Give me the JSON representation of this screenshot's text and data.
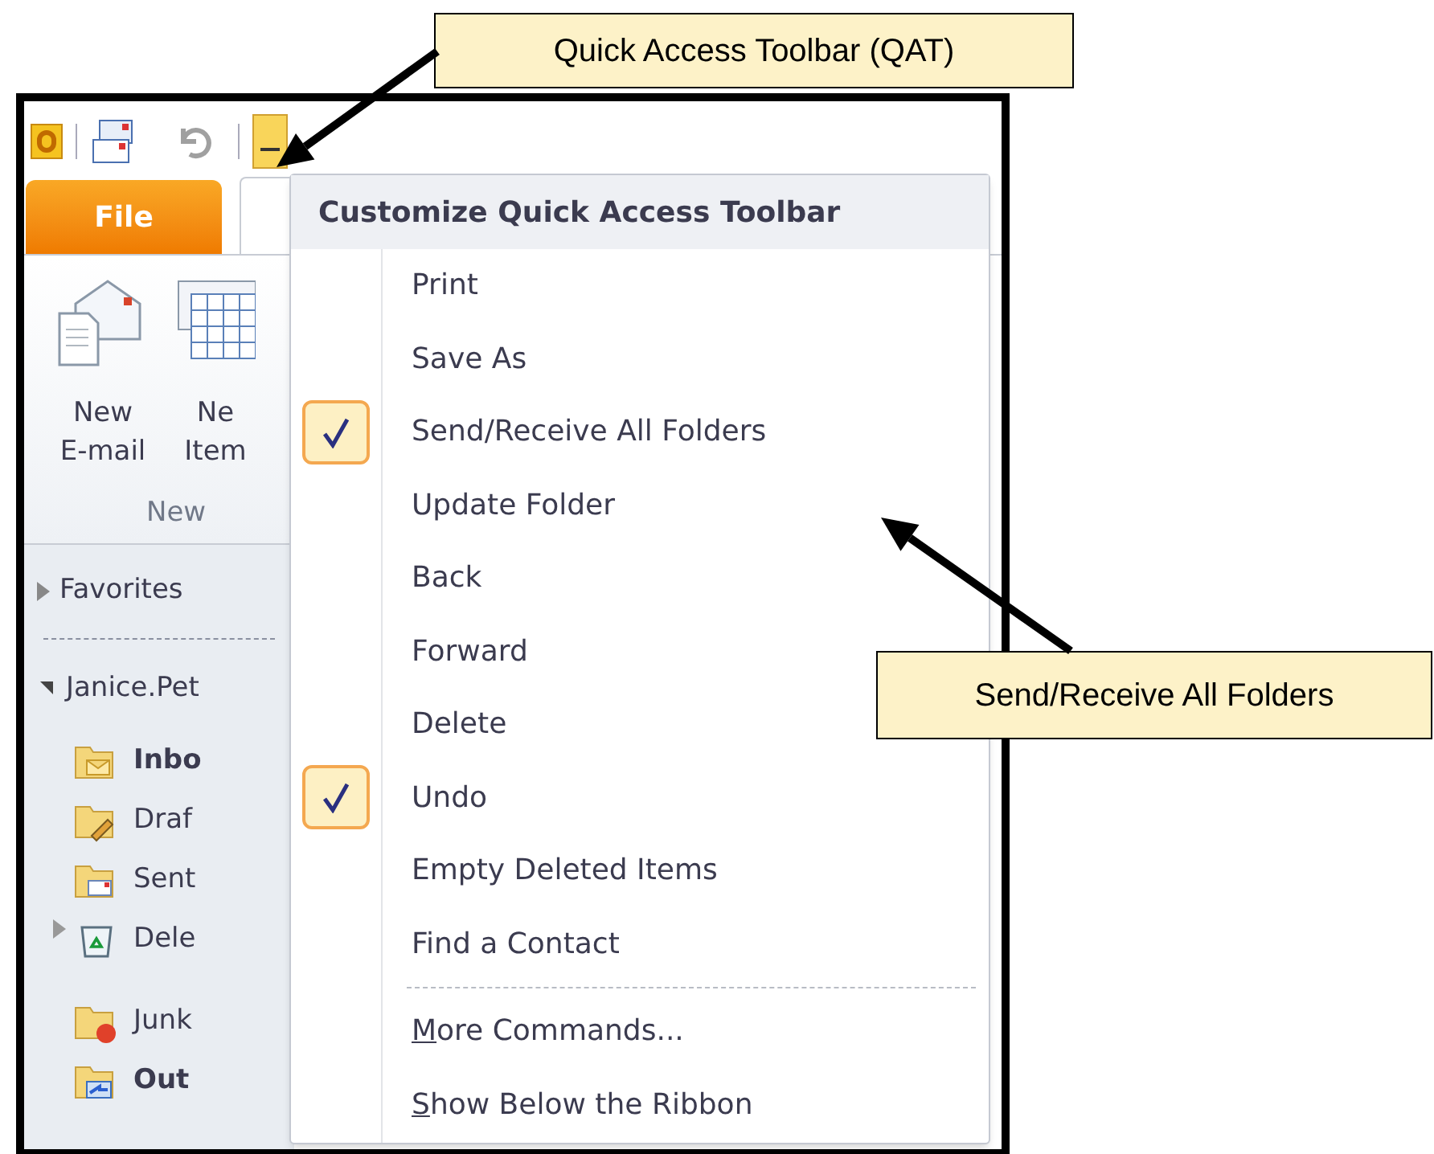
{
  "callouts": [
    {
      "text": "Quick Access Toolbar (QAT)",
      "kind": "qat"
    },
    {
      "text": "Send/Receive All Folders",
      "kind": "menu"
    }
  ],
  "tabs": [
    {
      "label": "File",
      "kind": "file"
    }
  ],
  "ribbon": {
    "buttons": [
      {
        "line1": "New",
        "line2": "E-mail",
        "kind": "mail"
      },
      {
        "line1": "Ne",
        "line2": "Item",
        "kind": "items"
      }
    ],
    "group_label": "New"
  },
  "nav": {
    "favorites": {
      "label": "Favorites",
      "expanded": false
    },
    "account": {
      "label": "Janice.Pet",
      "expanded": true
    },
    "folders": [
      {
        "label": "Inbo",
        "bold": true,
        "has_children": false,
        "kind": "inbox"
      },
      {
        "label": "Draf",
        "bold": false,
        "has_children": false,
        "kind": "drafts"
      },
      {
        "label": "Sent",
        "bold": false,
        "has_children": false,
        "kind": "sent"
      },
      {
        "label": "Dele",
        "bold": false,
        "has_children": true,
        "kind": "deleted"
      },
      {
        "label": "Junk",
        "bold": false,
        "has_children": false,
        "kind": "junk"
      },
      {
        "label": "Out",
        "bold": true,
        "has_children": false,
        "kind": "outbox"
      }
    ]
  },
  "menu": {
    "title": "Customize Quick Access Toolbar",
    "items": [
      {
        "label": "Print",
        "checked": false
      },
      {
        "label": "Save As",
        "checked": false
      },
      {
        "label": "Send/Receive All Folders",
        "checked": true
      },
      {
        "label": "Update Folder",
        "checked": false
      },
      {
        "label": "Back",
        "checked": false
      },
      {
        "label": "Forward",
        "checked": false
      },
      {
        "label": "Delete",
        "checked": false
      },
      {
        "label": "Undo",
        "checked": true
      },
      {
        "label": "Empty Deleted Items",
        "checked": false
      },
      {
        "label": "Find a Contact",
        "checked": false
      }
    ],
    "options": [
      {
        "label": "More Commands...",
        "underline_first": true
      },
      {
        "label": "Show Below the Ribbon",
        "underline_first": true
      }
    ]
  }
}
